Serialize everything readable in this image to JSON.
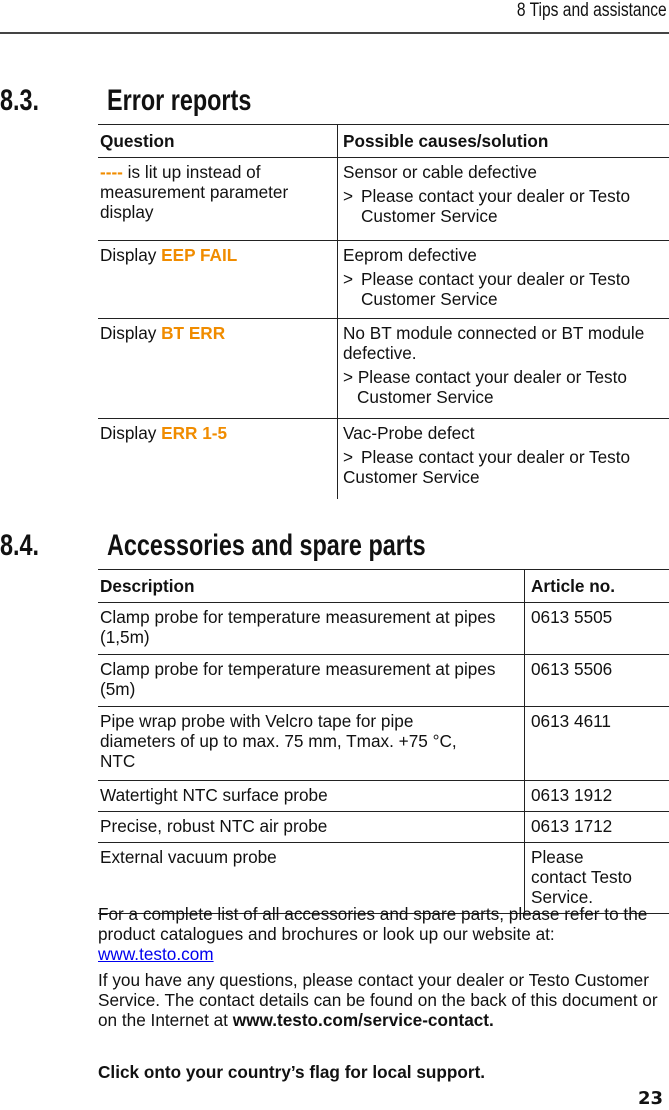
{
  "header": {
    "chapter_title": "8 Tips and assistance"
  },
  "section_errors": {
    "number": "8.3.",
    "title": "Error reports",
    "columns": [
      "Question",
      "Possible causes/solution"
    ],
    "rows": [
      {
        "question_highlight": "----",
        "question_prefix": "",
        "question_suffix": " is lit up instead of measurement parameter display",
        "cause": "Sensor or cable defective",
        "step_marker": ">",
        "step": "Please contact your dealer or Testo Customer Service"
      },
      {
        "question_prefix": "Display ",
        "question_highlight": "EEP FAIL",
        "question_suffix": "",
        "cause": "Eeprom defective",
        "step_marker": ">",
        "step": "Please contact your dealer or Testo Customer Service"
      },
      {
        "question_prefix": "Display ",
        "question_highlight": "BT ERR",
        "question_suffix": "",
        "cause": "No BT module connected or BT module defective.",
        "step_marker": ">",
        "step": "Please contact your dealer or Testo Customer Service"
      },
      {
        "question_prefix": "Display ",
        "question_highlight": "ERR 1-5",
        "question_suffix": "",
        "cause": "Vac-Probe defect",
        "step_marker": ">",
        "step": "Please contact your dealer or Testo Customer Service"
      }
    ],
    "highlight_color": "#f08c00"
  },
  "section_parts": {
    "number": "8.4.",
    "title": "Accessories and spare parts",
    "columns": [
      "Description",
      "Article no."
    ],
    "rows": [
      {
        "description": "Clamp probe for temperature measurement at pipes (1,5m)",
        "article": "0613 5505"
      },
      {
        "description": "Clamp probe for temperature measurement at pipes (5m)",
        "article": "0613 5506"
      },
      {
        "description": "Pipe wrap probe with Velcro tape for pipe diameters of up to max. 75 mm, Tmax. +75 °C, NTC",
        "article": "0613 4611"
      },
      {
        "description": "Watertight NTC surface probe",
        "article": "0613 1912"
      },
      {
        "description": "Precise, robust NTC air probe",
        "article": "0613 1712"
      },
      {
        "description": "External vacuum probe",
        "article": "Please contact Testo Service."
      }
    ]
  },
  "notes": {
    "catalogue_text": "For a complete list of all accessories and spare parts, please refer to the product catalogues and brochures or look up our website at:",
    "website_link": "www.testo.com",
    "contact_text": "If you have any questions, please contact your dealer or Testo Customer Service. The contact details can be found on the back of this document or on the Internet at ",
    "contact_link": "www.testo.com/service-contact.",
    "flag_text": "Click onto your country’s flag for local support."
  },
  "footer": {
    "page_number": "23"
  }
}
